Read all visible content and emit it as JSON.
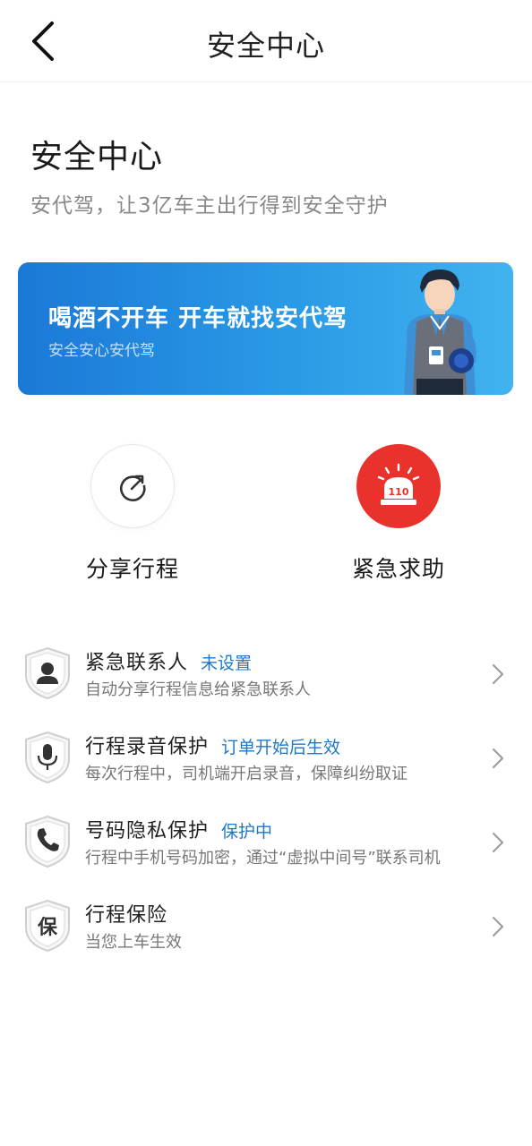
{
  "nav": {
    "title": "安全中心"
  },
  "hero": {
    "title": "安全中心",
    "subtitle": "安代驾，让3亿车主出行得到安全守护"
  },
  "banner": {
    "title": "喝酒不开车 开车就找安代驾",
    "subtitle": "安全安心安代驾"
  },
  "actions": {
    "share": {
      "label": "分享行程",
      "icon": "share-trip-icon"
    },
    "sos": {
      "label": "紧急求助",
      "icon": "alarm-110-icon",
      "badge": "110",
      "color": "#e8322b"
    }
  },
  "items": [
    {
      "title": "紧急联系人",
      "tag": "未设置",
      "desc": "自动分享行程信息给紧急联系人",
      "icon": "person-icon"
    },
    {
      "title": "行程录音保护",
      "tag": "订单开始后生效",
      "desc": "每次行程中，司机端开启录音，保障纠纷取证",
      "icon": "microphone-icon"
    },
    {
      "title": "号码隐私保护",
      "tag": "保护中",
      "desc": "行程中手机号码加密，通过“虚拟中间号”联系司机",
      "icon": "phone-icon"
    },
    {
      "title": "行程保险",
      "tag": "",
      "desc": "当您上车生效",
      "icon": "insurance-icon",
      "glyph": "保"
    }
  ],
  "colors": {
    "accent": "#1d78c9",
    "danger": "#e8322b",
    "banner_start": "#1b79d6",
    "banner_end": "#41b3ee"
  }
}
